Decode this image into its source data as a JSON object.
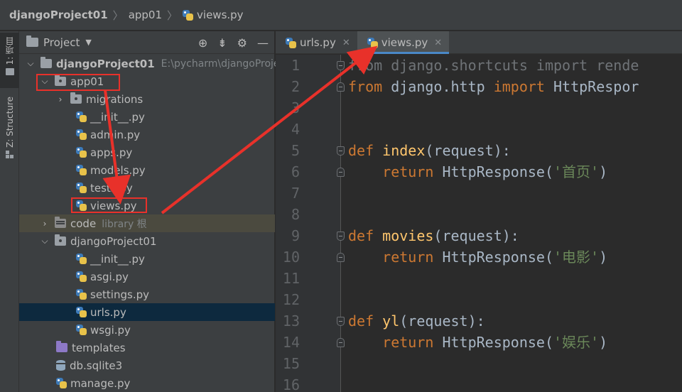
{
  "breadcrumb": {
    "project": "djangoProject01",
    "folder": "app01",
    "file": "views.py"
  },
  "toolstrip": {
    "project_tab": "1: 项目",
    "structure_tab": "Z: Structure"
  },
  "project_panel": {
    "title": "Project",
    "header_icons": [
      "target-icon",
      "collapse-icon",
      "gear-icon",
      "minimize-icon"
    ]
  },
  "tree": {
    "root": {
      "name": "djangoProject01",
      "path": "E:\\pycharm\\djangoProje"
    },
    "app01": "app01",
    "migrations": "migrations",
    "app01_init": "__init__.py",
    "admin": "admin.py",
    "apps": "apps.py",
    "models": "models.py",
    "tests": "tests.py",
    "views": "views.py",
    "code": "code",
    "code_suffix": "library 根",
    "pkg": "djangoProject01",
    "pkg_init": "__init__.py",
    "asgi": "asgi.py",
    "settings": "settings.py",
    "urls": "urls.py",
    "wsgi": "wsgi.py",
    "templates": "templates",
    "db": "db.sqlite3",
    "manage": "manage.py"
  },
  "editor": {
    "tabs": [
      {
        "label": "urls.py",
        "active": false
      },
      {
        "label": "views.py",
        "active": true
      }
    ],
    "line_numbers": [
      "1",
      "2",
      "3",
      "4",
      "5",
      "6",
      "7",
      "8",
      "9",
      "10",
      "11",
      "12",
      "13",
      "14",
      "15",
      "16"
    ],
    "code": {
      "l1_from": "from",
      "l1_mod": " django.shortcuts ",
      "l1_import": "import",
      "l1_rest": " rende",
      "l2_from": "from",
      "l2_mod": " django.http ",
      "l2_import": "import",
      "l2_rest": " HttpRespor",
      "l5_def": "def",
      "l5_name": "index",
      "l5_args": "(request):",
      "l6_return": "return",
      "l6_call": " HttpResponse(",
      "l6_str": "'首页'",
      "l6_end": ")",
      "l9_def": "def",
      "l9_name": "movies",
      "l9_args": "(request):",
      "l10_return": "return",
      "l10_call": " HttpResponse(",
      "l10_str": "'电影'",
      "l10_end": ")",
      "l13_def": "def",
      "l13_name": "yl",
      "l13_args": "(request):",
      "l14_return": "return",
      "l14_call": " HttpResponse(",
      "l14_str": "'娱乐'",
      "l14_end": ")"
    }
  },
  "colors": {
    "annotation_red": "#e8312a",
    "selection": "#0d293e",
    "keyword": "#cc7832",
    "function": "#ffc66d",
    "string": "#6a8759"
  }
}
